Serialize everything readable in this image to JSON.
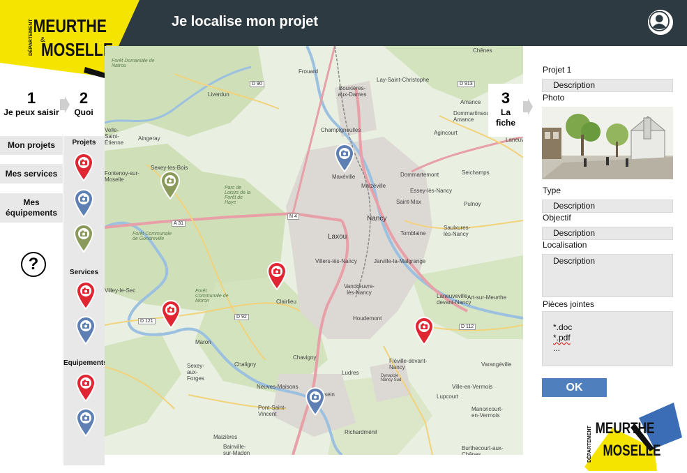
{
  "header": {
    "title": "Je localise  mon projet"
  },
  "logo": {
    "line1": "MEURTHE",
    "line2": "MOSELLE",
    "vertical": "DÉPARTEMENT",
    "amp": "&"
  },
  "steps": [
    {
      "num": "1",
      "label": "Je peux saisir"
    },
    {
      "num": "2",
      "label": "Quoi"
    },
    {
      "num": "3",
      "label_line1": "La",
      "label_line2": "fiche"
    }
  ],
  "menu": {
    "items": [
      {
        "label": "Mon projets"
      },
      {
        "label": "Mes services"
      },
      {
        "label_line1": "Mes",
        "label_line2": "équipements"
      }
    ],
    "help_icon": "?"
  },
  "categories": [
    {
      "label": "Projets",
      "pins": [
        "red",
        "blue",
        "green"
      ]
    },
    {
      "label": "Services",
      "pins": [
        "red",
        "blue"
      ]
    },
    {
      "label": "Equipements",
      "pins": [
        "red",
        "blue"
      ]
    }
  ],
  "map": {
    "places": [
      "Chênes",
      "Frouard",
      "Bouxières-aux-Dames",
      "Lay-Saint-Christophe",
      "Forêt Domaniale de Natrou",
      "Liverdun",
      "Champigneulles",
      "Agincourt",
      "Laneuvelle",
      "Amance",
      "Dommartinsous-Amance",
      "Aingeray",
      "Velle-Saint-Étienne",
      "Sexey-les-Bois",
      "Maxéville",
      "Malzéville",
      "Essey-lès-Nancy",
      "Seichamps",
      "Dommartemont",
      "Saint-Max",
      "Pulnoy",
      "Parc de Loisirs de la Forêt de Haye",
      "Fontenoy-sur-Moselle",
      "Nancy",
      "Laxou",
      "Tomblaine",
      "Saulxures-lès-Nancy",
      "Villers-lès-Nancy",
      "Jarville-la-Malgrange",
      "Forêt Communale de Gondreville",
      "Vandœuvre-lès-Nancy",
      "Clairlieu",
      "Villey-le-Sec",
      "Houdemont",
      "Art-sur-Meurthe",
      "Laneuveville-devant-Nancy",
      "Forêt Communale de Moron",
      "Maron",
      "Fléville-devant-Nancy",
      "Sexey-aux-Forges",
      "Chaligny",
      "Chavigny",
      "Ludres",
      "Neuves-Maisons",
      "Messein",
      "Ville-en-Vermois",
      "Pont-Saint-Vincent",
      "Lupcourt",
      "Manoncourt-en-Vermois",
      "Richardménil",
      "Maizières",
      "Burthecourt-aux-Chênes",
      "Bainville-sur-Madon",
      "Varangéville",
      "Dynapole Nancy Sud"
    ],
    "roads": [
      "D 90",
      "D 913",
      "A 31",
      "D 121",
      "D 92",
      "D 112",
      "N 4"
    ]
  },
  "form": {
    "project_title": "Projet 1",
    "description_value": "Description",
    "photo_label": "Photo",
    "type_label": "Type",
    "type_value": "Description",
    "objectif_label": "Objectif",
    "objectif_value": "Description",
    "localisation_label": "Localisation",
    "localisation_value": "Description",
    "pieces_label": "Pièces jointes",
    "pieces_values": [
      "*.doc",
      "*.pdf",
      "..."
    ],
    "ok_label": "OK"
  },
  "colors": {
    "header_bg": "#2e3a42",
    "logo_yellow": "#f5e400",
    "pin_red": "#e02633",
    "pin_blue": "#5d7fb3",
    "pin_green": "#8a9a5b",
    "ok_button": "#4f7fbd",
    "logo_blue": "#3a6db5"
  }
}
